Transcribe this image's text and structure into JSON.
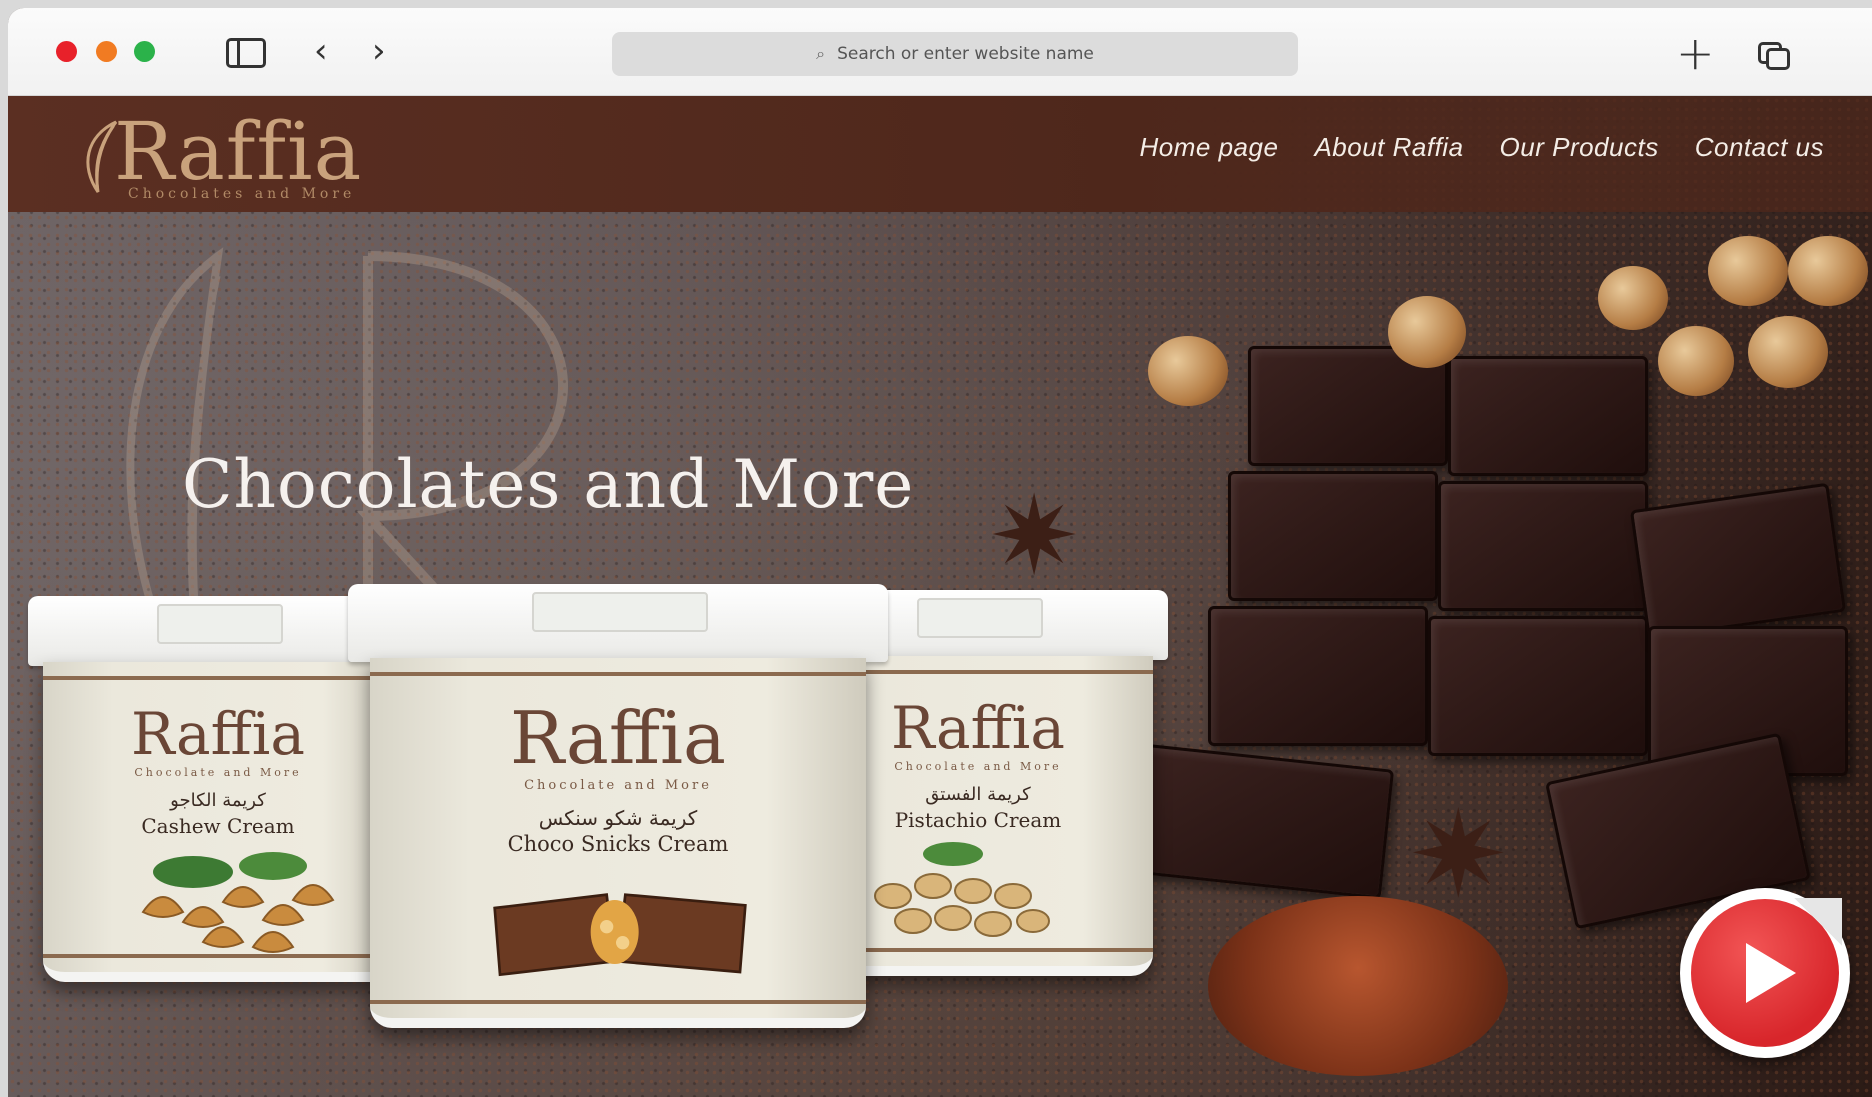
{
  "browser": {
    "url_placeholder": "Search or enter website name",
    "icons": [
      "close-dot",
      "minimize-dot",
      "zoom-dot",
      "sidebar-icon",
      "back-icon",
      "forward-icon",
      "search-icon",
      "new-tab-icon",
      "tabs-overview-icon"
    ]
  },
  "site": {
    "logo": {
      "word": "Raffia",
      "tagline": "Chocolates and More"
    },
    "nav": [
      {
        "label": "Home page"
      },
      {
        "label": "About Raffia"
      },
      {
        "label": "Our Products"
      },
      {
        "label": "Contact us"
      }
    ],
    "hero_title": "Chocolates and More",
    "products": [
      {
        "brand": "Raffia",
        "brand_sub": "Chocolate and More",
        "name_ar": "كريمة الكاجو",
        "name_en": "Cashew Cream"
      },
      {
        "brand": "Raffia",
        "brand_sub": "Chocolate and More",
        "name_ar": "كريمة شكو سنكس",
        "name_en": "Choco Snicks Cream"
      },
      {
        "brand": "Raffia",
        "brand_sub": "Chocolate and More",
        "name_ar": "كريمة الفستق",
        "name_en": "Pistachio Cream"
      }
    ],
    "colors": {
      "header": "#4e271b",
      "logo": "#c9a27c",
      "play": "#d8262b"
    }
  }
}
